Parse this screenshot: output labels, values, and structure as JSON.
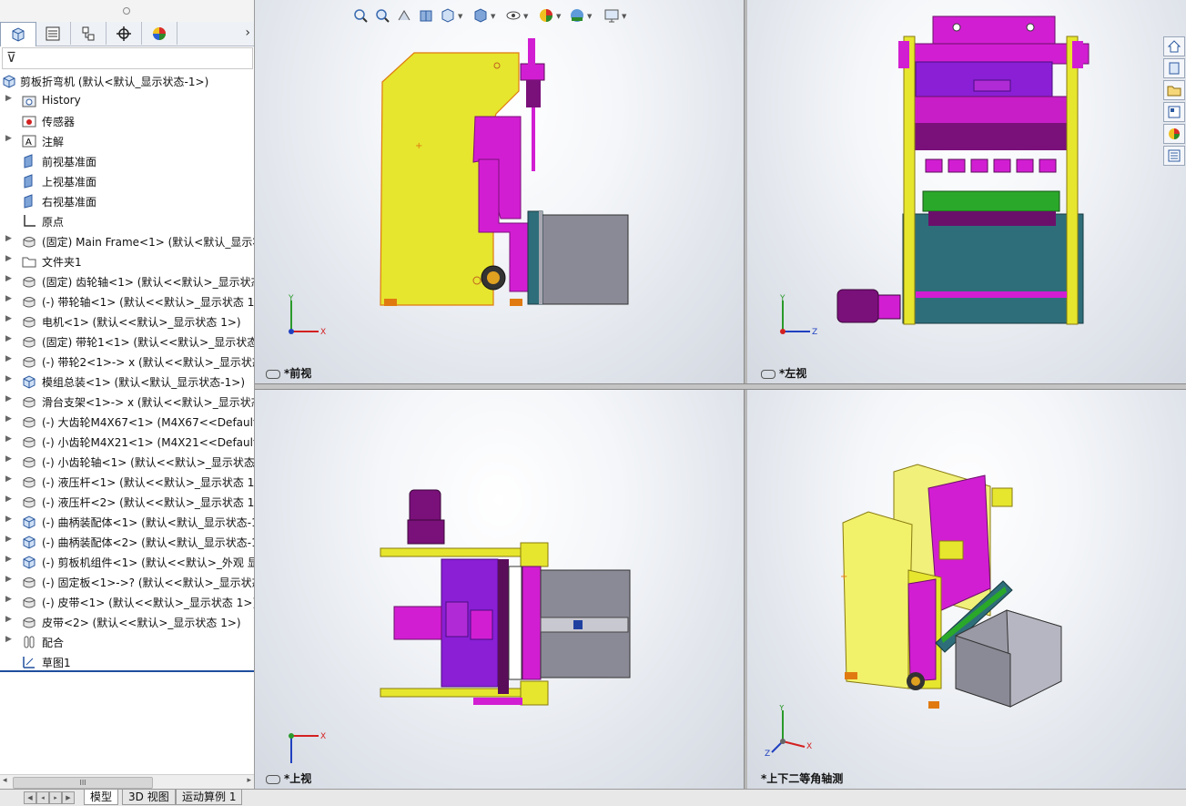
{
  "feature_tree": {
    "tabs": [
      "feature-manager",
      "property-manager",
      "configuration-manager",
      "dimxpert-manager",
      "display-manager"
    ],
    "filter_icon": "funnel-icon",
    "root": "剪板折弯机 (默认<默认_显示状态-1>)",
    "items": [
      {
        "label": "History",
        "icon": "history-folder-icon",
        "expand": true
      },
      {
        "label": "传感器",
        "icon": "sensor-icon",
        "expand": false
      },
      {
        "label": "注解",
        "icon": "annotation-icon",
        "expand": true
      },
      {
        "label": "前视基准面",
        "icon": "plane-icon",
        "expand": false
      },
      {
        "label": "上视基准面",
        "icon": "plane-icon",
        "expand": false
      },
      {
        "label": "右视基准面",
        "icon": "plane-icon",
        "expand": false
      },
      {
        "label": "原点",
        "icon": "origin-icon",
        "expand": false
      },
      {
        "label": "(固定) Main Frame<1> (默认<默认_显示状",
        "icon": "part-icon",
        "expand": true
      },
      {
        "label": "文件夹1",
        "icon": "folder-icon",
        "expand": true
      },
      {
        "label": "(固定) 齿轮轴<1> (默认<<默认>_显示状态",
        "icon": "part-icon",
        "expand": true
      },
      {
        "label": "(-) 带轮轴<1> (默认<<默认>_显示状态 1>",
        "icon": "part-icon",
        "expand": true
      },
      {
        "label": "电机<1> (默认<<默认>_显示状态 1>)",
        "icon": "part-icon",
        "expand": true
      },
      {
        "label": "(固定) 带轮1<1> (默认<<默认>_显示状态",
        "icon": "part-icon",
        "expand": true
      },
      {
        "label": "(-) 带轮2<1>-> x (默认<<默认>_显示状态",
        "icon": "part-icon",
        "expand": true
      },
      {
        "label": "模组总装<1> (默认<默认_显示状态-1>)",
        "icon": "subassembly-icon",
        "expand": true
      },
      {
        "label": "滑台支架<1>-> x (默认<<默认>_显示状态",
        "icon": "part-icon",
        "expand": true
      },
      {
        "label": "(-) 大齿轮M4X67<1> (M4X67<<Default>",
        "icon": "part-icon",
        "expand": true
      },
      {
        "label": "(-) 小齿轮M4X21<1> (M4X21<<Default>",
        "icon": "part-icon",
        "expand": true
      },
      {
        "label": "(-) 小齿轮轴<1> (默认<<默认>_显示状态 1",
        "icon": "part-icon",
        "expand": true
      },
      {
        "label": "(-) 液压杆<1> (默认<<默认>_显示状态 1>",
        "icon": "part-icon",
        "expand": true
      },
      {
        "label": "(-) 液压杆<2> (默认<<默认>_显示状态 1>",
        "icon": "part-icon",
        "expand": true
      },
      {
        "label": "(-) 曲柄装配体<1> (默认<默认_显示状态-1",
        "icon": "subassembly-icon",
        "expand": true
      },
      {
        "label": "(-) 曲柄装配体<2> (默认<默认_显示状态-1",
        "icon": "subassembly-icon",
        "expand": true
      },
      {
        "label": "(-) 剪板机组件<1> (默认<<默认>_外观 显",
        "icon": "subassembly-icon",
        "expand": true
      },
      {
        "label": "(-) 固定板<1>->? (默认<<默认>_显示状态",
        "icon": "part-icon",
        "expand": true
      },
      {
        "label": "(-) 皮带<1> (默认<<默认>_显示状态 1>)",
        "icon": "part-icon",
        "expand": true
      },
      {
        "label": "皮带<2> (默认<<默认>_显示状态 1>)",
        "icon": "part-icon",
        "expand": true
      },
      {
        "label": "配合",
        "icon": "mates-icon",
        "expand": true
      },
      {
        "label": "草图1",
        "icon": "sketch-icon",
        "expand": false
      }
    ],
    "scroll_grip": "III"
  },
  "viewports": {
    "front": {
      "label": "*前视",
      "axis": {
        "up": "Y",
        "right": "X"
      }
    },
    "left": {
      "label": "*左视",
      "axis": {
        "up": "Y",
        "right": "Z"
      }
    },
    "top": {
      "label": "*上视",
      "axis": {
        "up": "X",
        "right": "X"
      }
    },
    "iso": {
      "label": "*上下二等角轴测",
      "axis": {
        "up": "Y",
        "right": "X",
        "depth": "Z"
      }
    }
  },
  "bottom_tabs": [
    "模型",
    "3D 视图",
    "运动算例 1"
  ],
  "heads_up_toolbar": [
    "zoom-to-fit-icon",
    "zoom-to-area-icon",
    "previous-view-icon",
    "section-view-icon",
    "view-orientation-icon",
    "display-style-icon",
    "hide-show-icon",
    "edit-appearance-icon",
    "apply-scene-icon",
    "view-settings-icon"
  ],
  "task_pane": [
    "home-icon",
    "design-library-icon",
    "file-explorer-icon",
    "view-palette-icon",
    "appearances-icon",
    "custom-properties-icon"
  ],
  "colors": {
    "frame_yellow": "#e6e62e",
    "magenta": "#d21ed2",
    "purple": "#8a1fd6",
    "grey_block": "#8a8a96",
    "teal": "#2e6e7a",
    "green": "#2aa82a",
    "tree_selection_line": "#1f4e9e"
  }
}
